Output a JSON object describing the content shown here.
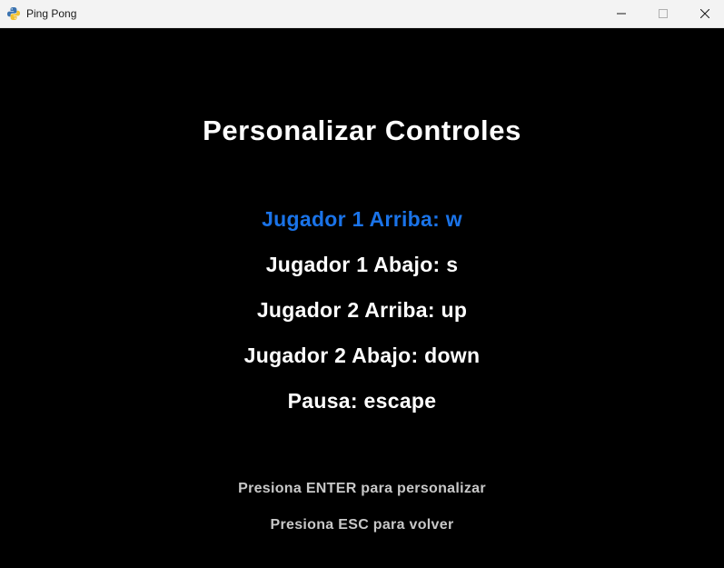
{
  "window": {
    "title": "Ping Pong",
    "app_icon": "python-icon"
  },
  "screen": {
    "title": "Personalizar Controles",
    "controls": [
      {
        "label": "Jugador 1 Arriba: w",
        "selected": true
      },
      {
        "label": "Jugador 1 Abajo: s",
        "selected": false
      },
      {
        "label": "Jugador 2 Arriba: up",
        "selected": false
      },
      {
        "label": "Jugador 2 Abajo: down",
        "selected": false
      },
      {
        "label": "Pausa: escape",
        "selected": false
      }
    ],
    "hints": [
      "Presiona ENTER para personalizar",
      "Presiona ESC para volver"
    ]
  },
  "colors": {
    "background": "#000000",
    "text": "#ffffff",
    "selected": "#1a73e8",
    "hint": "#c8c8c8",
    "titlebar": "#f3f3f3"
  }
}
